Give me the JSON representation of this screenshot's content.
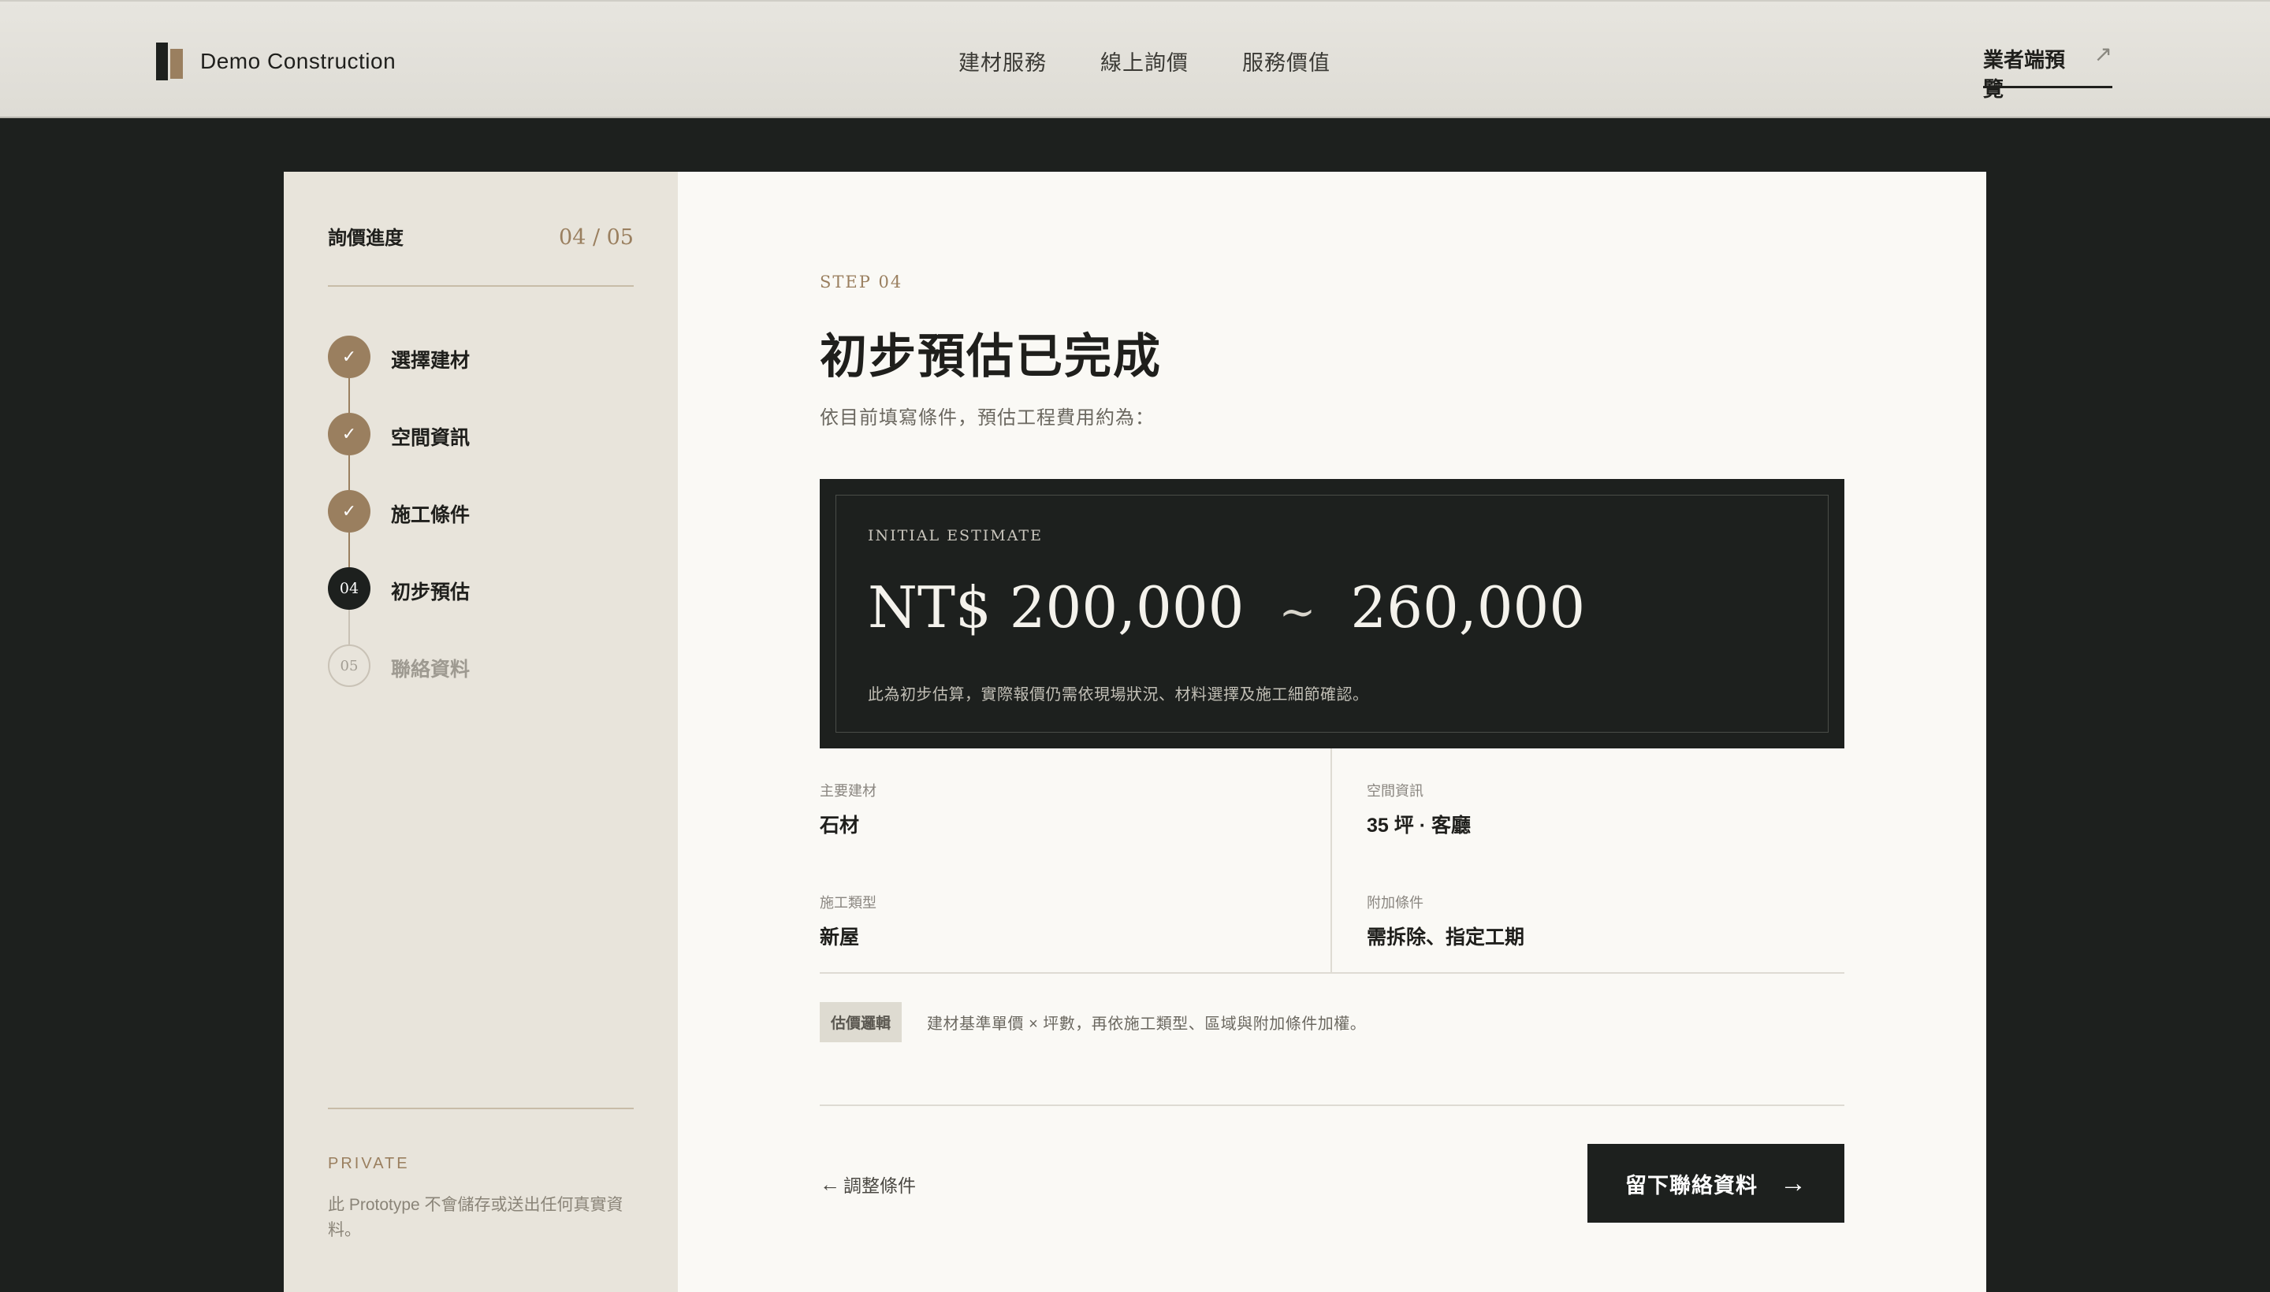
{
  "header": {
    "brand": "Demo Construction",
    "nav": [
      "建材服務",
      "線上詢價",
      "服務價值"
    ],
    "vendor_link": "業者端預覽",
    "vendor_icon": "external-arrow-icon"
  },
  "sidebar": {
    "title": "詢價進度",
    "count": "04 / 05",
    "steps": [
      {
        "marker": "✓",
        "label": "選擇建材",
        "state": "done"
      },
      {
        "marker": "✓",
        "label": "空間資訊",
        "state": "done"
      },
      {
        "marker": "✓",
        "label": "施工條件",
        "state": "done"
      },
      {
        "marker": "04",
        "label": "初步預估",
        "state": "current"
      },
      {
        "marker": "05",
        "label": "聯絡資料",
        "state": "todo"
      }
    ],
    "private_title": "PRIVATE",
    "private_text": "此 Prototype 不會儲存或送出任何真實資料。"
  },
  "main": {
    "step_kicker": "STEP 04",
    "title": "初步預估已完成",
    "subtitle": "依目前填寫條件，預估工程費用約為：",
    "estimate": {
      "label": "INITIAL ESTIMATE",
      "low": "NT$ 200,000",
      "separator": "~",
      "high": "260,000",
      "note": "此為初步估算，實際報價仍需依現場狀況、材料選擇及施工細節確認。"
    },
    "summary": {
      "material_key": "主要建材",
      "material_val": "石材",
      "space_key": "空間資訊",
      "space_val": "35 坪 · 客廳",
      "type_key": "施工類型",
      "type_val": "新屋",
      "extra_key": "附加條件",
      "extra_val": "需拆除、指定工期"
    },
    "logic_tag": "估價邏輯",
    "logic_text": "建材基準單價 × 坪數，再依施工類型、區域與附加條件加權。",
    "back_label": "調整條件",
    "cta_label": "留下聯絡資料"
  },
  "colors": {
    "accent": "#9a7f5f",
    "dark": "#1d201e",
    "sidebar_bg": "#e8e4db",
    "main_bg": "#faf9f5"
  }
}
